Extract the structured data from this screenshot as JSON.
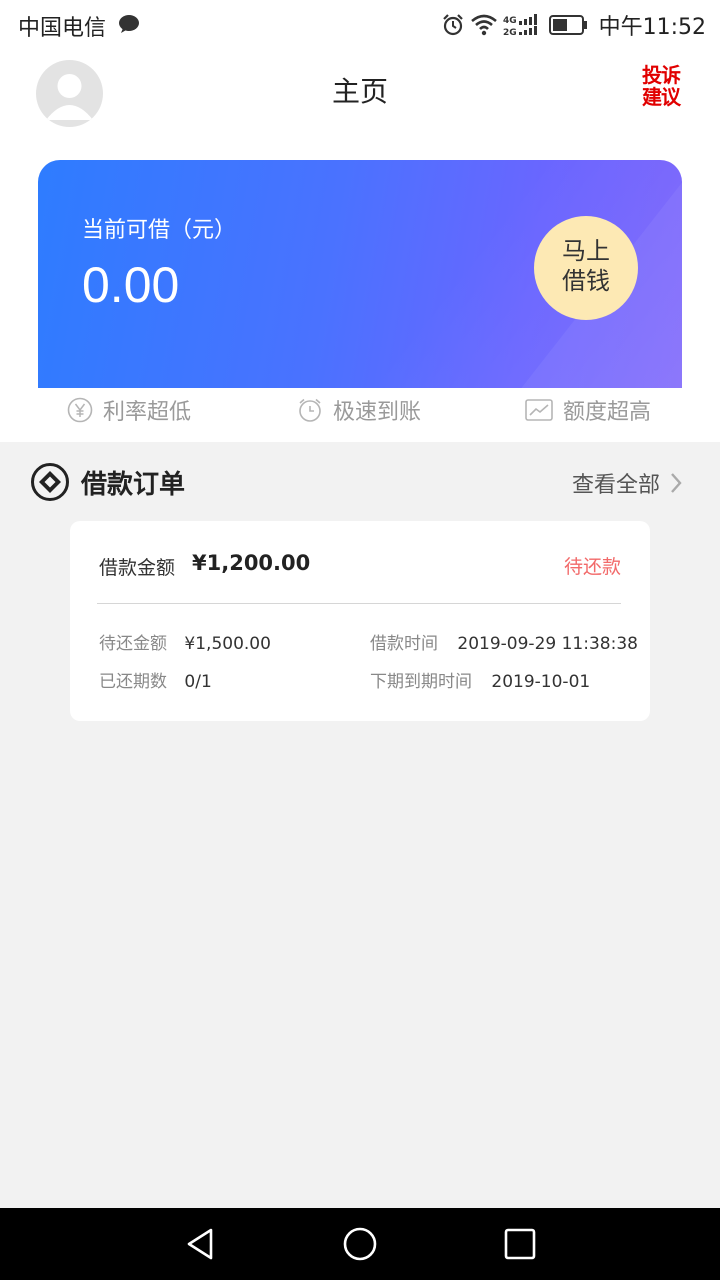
{
  "status_bar": {
    "carrier": "中国电信",
    "time": "中午11:52",
    "network": "4G 2G"
  },
  "header": {
    "title": "主页",
    "complaint_line1": "投诉",
    "complaint_line2": "建议"
  },
  "balance_card": {
    "label": "当前可借（元）",
    "amount": "0.00",
    "borrow_line1": "马上",
    "borrow_line2": "借钱"
  },
  "features": [
    {
      "label": "利率超低",
      "icon": "yen-circle-icon"
    },
    {
      "label": "极速到账",
      "icon": "alarm-clock-icon"
    },
    {
      "label": "额度超高",
      "icon": "trend-chart-icon"
    }
  ],
  "orders": {
    "title": "借款订单",
    "view_all": "查看全部"
  },
  "order": {
    "amount_label": "借款金额",
    "amount": "¥1,200.00",
    "status": "待还款",
    "pending_label": "待还金额",
    "pending_value": "¥1,500.00",
    "loan_time_label": "借款时间",
    "loan_time_value": "2019-09-29 11:38:38",
    "periods_label": "已还期数",
    "periods_value": "0/1",
    "due_label": "下期到期时间",
    "due_value": "2019-10-01"
  },
  "colors": {
    "card_gradient_start": "#2e7cff",
    "card_gradient_end": "#7a62fb",
    "borrow_button": "#fde9b4",
    "complaint": "#e10000",
    "status_pending": "#f26a6a"
  }
}
